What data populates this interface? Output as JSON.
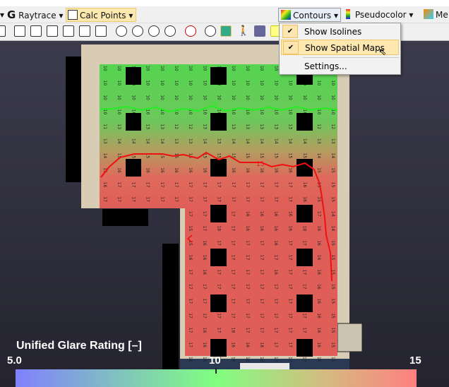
{
  "toolbar": {
    "raytrace": "Raytrace",
    "calc_points": "Calc Points",
    "contours": "Contours",
    "pseudocolor": "Pseudocolor",
    "more": "Me"
  },
  "menu": {
    "items": [
      {
        "label": "Show Isolines",
        "checked": true
      },
      {
        "label": "Show Spatial Maps",
        "checked": true,
        "highlighted": true
      },
      {
        "label": "Settings..."
      }
    ]
  },
  "legend": {
    "title": "Unified Glare Rating [–]",
    "min": "5.0",
    "mid": "10",
    "max": "15",
    "colors": [
      "#8080ff",
      "#80ff80",
      "#ff8080"
    ]
  },
  "isolines": [
    {
      "label": "10",
      "color": "#22ee22"
    },
    {
      "label": "15",
      "color": "#ee1111"
    }
  ],
  "grid": {
    "upper": [
      [
        10,
        10,
        10,
        10,
        10,
        10,
        10,
        10,
        10,
        10,
        10,
        10,
        10,
        10,
        10,
        10,
        10
      ],
      [
        10,
        10,
        10,
        10,
        10,
        10,
        10,
        10,
        10,
        10,
        10,
        10,
        10,
        10,
        10,
        10,
        10
      ],
      [
        10,
        10,
        10,
        10,
        10,
        10,
        10,
        10,
        10,
        10,
        10,
        10,
        10,
        10,
        10,
        10,
        10
      ],
      [
        10,
        10,
        10,
        10,
        10,
        10,
        10,
        10,
        10,
        10,
        10,
        10,
        10,
        10,
        10,
        10,
        10
      ],
      [
        11,
        13,
        13,
        13,
        13,
        12,
        12,
        13,
        13,
        13,
        13,
        13,
        13,
        13,
        12,
        12,
        12
      ],
      [
        13,
        14,
        14,
        14,
        14,
        13,
        13,
        14,
        13,
        14,
        14,
        14,
        14,
        14,
        14,
        13,
        13
      ],
      [
        14,
        15,
        15,
        15,
        15,
        15,
        15,
        15,
        15,
        15,
        15,
        15,
        15,
        15,
        15,
        14,
        14
      ],
      [
        15,
        16,
        16,
        16,
        16,
        16,
        16,
        16,
        16,
        16,
        16,
        16,
        16,
        16,
        16,
        15,
        15
      ],
      [
        16,
        17,
        17,
        17,
        17,
        17,
        17,
        17,
        17,
        17,
        17,
        17,
        17,
        17,
        16,
        15,
        15
      ],
      [
        17,
        17,
        17,
        17,
        17,
        17,
        17,
        17,
        17,
        17,
        17,
        17,
        17,
        17,
        16,
        15,
        15
      ]
    ],
    "lower": [
      [
        17,
        17,
        18,
        17,
        16,
        16,
        16,
        16,
        18,
        17,
        14
      ],
      [
        15,
        17,
        18,
        17,
        16,
        16,
        16,
        16,
        18,
        16,
        14
      ],
      [
        15,
        16,
        17,
        17,
        17,
        17,
        16,
        17,
        17,
        16,
        15
      ],
      [
        16,
        16,
        17,
        17,
        17,
        17,
        17,
        17,
        17,
        16,
        15
      ],
      [
        17,
        16,
        17,
        17,
        17,
        17,
        16,
        17,
        17,
        16,
        15
      ],
      [
        17,
        17,
        17,
        17,
        17,
        17,
        17,
        17,
        17,
        16,
        15
      ],
      [
        17,
        17,
        17,
        17,
        17,
        17,
        17,
        17,
        17,
        16,
        15
      ],
      [
        17,
        17,
        17,
        17,
        17,
        17,
        17,
        17,
        17,
        16,
        15
      ],
      [
        17,
        16,
        17,
        18,
        17,
        17,
        17,
        17,
        17,
        16,
        15
      ],
      [
        17,
        16,
        17,
        16,
        16,
        18,
        17,
        17,
        17,
        16,
        15
      ],
      [
        16,
        15,
        16,
        16,
        16,
        16,
        17,
        17,
        17,
        16,
        15
      ]
    ]
  }
}
